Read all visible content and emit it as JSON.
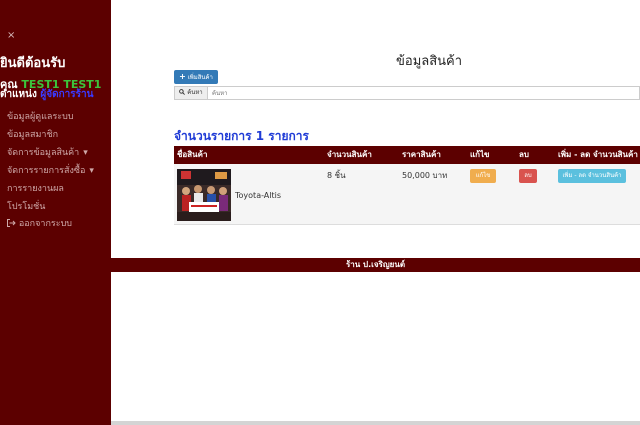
{
  "sidebar": {
    "close": "×",
    "welcome": "ยินดีต้อนรับ",
    "user_prefix": "คุณ",
    "user_name": "TEST1  TEST1",
    "role_prefix": "ตำแหน่ง",
    "role_value": "ผู้จัดการร้าน",
    "menu": [
      {
        "label": "ข้อมูลผู้ดูแลระบบ"
      },
      {
        "label": "ข้อมูลสมาชิก"
      },
      {
        "label": "จัดการข้อมูลสินค้า",
        "caret": "▾"
      },
      {
        "label": "จัดการรายการสั่งซื้อ",
        "caret": "▾"
      },
      {
        "label": "การรายงานผล"
      },
      {
        "label": "โปรโมชั่น"
      },
      {
        "label": "ออกจากระบบ"
      }
    ]
  },
  "main": {
    "title": "ข้อมูลสินค้า",
    "add_button": "เพิ่มสินค้า",
    "search": {
      "button": "ค้นหา",
      "placeholder": "ค้นหา"
    },
    "count_text": "จำนวนรายการ 1 รายการ",
    "table": {
      "headers": [
        "ชื่อสินค้า",
        "จำนวนสินค้า",
        "ราคาสินค้า",
        "แก้ไข",
        "ลบ",
        "เพิ่ม - ลด จำนวนสินค้า"
      ],
      "rows": [
        {
          "name": "Toyota-Altis",
          "quantity": "8 ชิ้น",
          "price": "50,000 บาท",
          "edit": "แก้ไข",
          "delete": "ลบ",
          "adjust": "เพิ่ม - ลด จำนวนสินค้า"
        }
      ]
    }
  },
  "footer": {
    "text": "ร้าน ป.เจริญยนต์"
  },
  "colors": {
    "theme": "#5c0000",
    "primary": "#337ab7",
    "warning": "#f0ad4e",
    "danger": "#d9534f",
    "info": "#5bc0de"
  },
  "icons": {
    "add": "plus-icon",
    "search": "search-icon",
    "logout": "logout-icon"
  }
}
